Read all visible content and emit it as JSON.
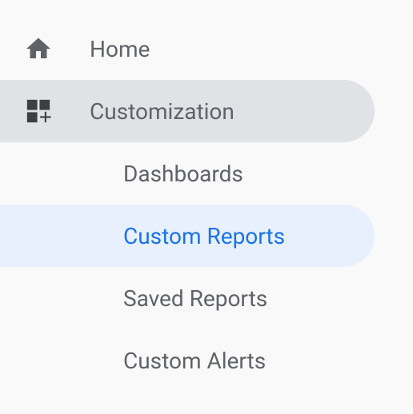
{
  "sidebar": {
    "home": {
      "label": "Home"
    },
    "customization": {
      "label": "Customization",
      "items": [
        {
          "label": "Dashboards"
        },
        {
          "label": "Custom Reports"
        },
        {
          "label": "Saved Reports"
        },
        {
          "label": "Custom Alerts"
        }
      ]
    }
  }
}
